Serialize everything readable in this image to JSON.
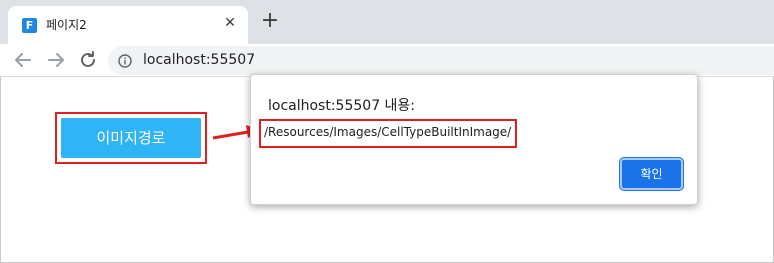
{
  "browser": {
    "tab": {
      "favicon_letter": "F",
      "title": "페이지2",
      "close_glyph": "✕"
    },
    "new_tab_glyph": "+",
    "url": "localhost:55507"
  },
  "page": {
    "button_label": "이미지경로"
  },
  "dialog": {
    "title": "localhost:55507 내용:",
    "message": "/Resources/Images/CellTypeBuiltInImage/",
    "ok_label": "확인"
  },
  "colors": {
    "accent": "#1a73e8",
    "page_button": "#2fb5f5",
    "highlight": "#e02020"
  }
}
